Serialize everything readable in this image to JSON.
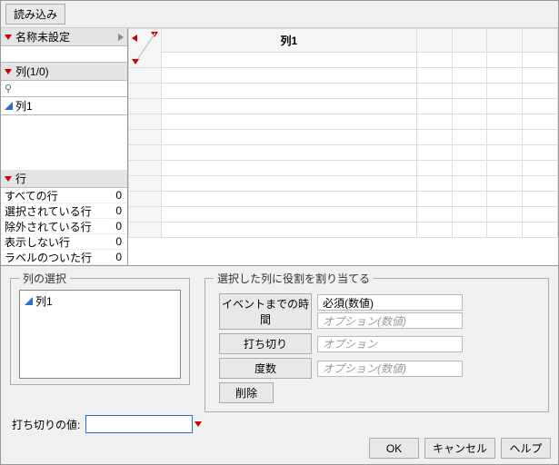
{
  "toolbar": {
    "load_label": "読み込み"
  },
  "left": {
    "name_header": "名称未設定",
    "columns_header": "列(1/0)",
    "search_glyph": "⚲",
    "col1": "列1",
    "rows_header": "行",
    "row_stats": [
      {
        "label": "すべての行",
        "value": 0
      },
      {
        "label": "選択されている行",
        "value": 0
      },
      {
        "label": "除外されている行",
        "value": 0
      },
      {
        "label": "表示しない行",
        "value": 0
      },
      {
        "label": "ラベルのついた行",
        "value": 0
      }
    ]
  },
  "grid": {
    "col_headers": [
      "列1",
      "",
      "",
      "",
      ""
    ]
  },
  "column_select": {
    "legend": "列の選択",
    "items": [
      "列1"
    ]
  },
  "assign": {
    "legend": "選択した列に役割を割り当てる",
    "rows": [
      {
        "button": "イベントまでの時間",
        "slots": [
          {
            "text": "必須(数値)",
            "placeholder": false
          },
          {
            "text": "オプション(数値)",
            "placeholder": true
          }
        ]
      },
      {
        "button": "打ち切り",
        "slots": [
          {
            "text": "オプション",
            "placeholder": true
          }
        ]
      },
      {
        "button": "度数",
        "slots": [
          {
            "text": "オプション(数値)",
            "placeholder": true
          }
        ]
      },
      {
        "button": "削除",
        "slots": []
      }
    ]
  },
  "censor": {
    "label": "打ち切りの値:",
    "value": ""
  },
  "buttons": {
    "ok": "OK",
    "cancel": "キャンセル",
    "help": "ヘルプ"
  }
}
